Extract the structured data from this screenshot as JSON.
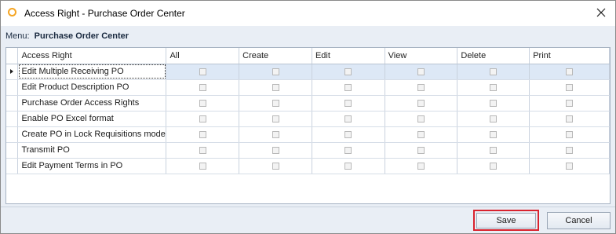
{
  "window": {
    "title": "Access Right - Purchase Order Center",
    "close_glyph": "✕"
  },
  "menu": {
    "label": "Menu:",
    "value": "Purchase Order Center"
  },
  "grid": {
    "columns": [
      "Access Right",
      "All",
      "Create",
      "Edit",
      "View",
      "Delete",
      "Print"
    ],
    "rows": [
      {
        "name": "Edit Multiple Receiving PO",
        "selected": true
      },
      {
        "name": "Edit Product Description PO",
        "selected": false
      },
      {
        "name": "Purchase Order Access Rights",
        "selected": false
      },
      {
        "name": "Enable PO Excel format",
        "selected": false
      },
      {
        "name": "Create PO in Lock Requisitions mode",
        "selected": false
      },
      {
        "name": "Transmit PO",
        "selected": false
      },
      {
        "name": "Edit Payment Terms in PO",
        "selected": false
      }
    ]
  },
  "buttons": {
    "save_label": "Save",
    "cancel_label": "Cancel"
  },
  "colors": {
    "highlight": "#d9232e",
    "app_icon": "#f5a524",
    "selected_row": "#dde8f6"
  },
  "icons": {
    "app": "app-circle-icon",
    "close": "close-icon",
    "row_indicator": "row-indicator-arrow-icon",
    "checkbox": "checkbox-icon"
  }
}
